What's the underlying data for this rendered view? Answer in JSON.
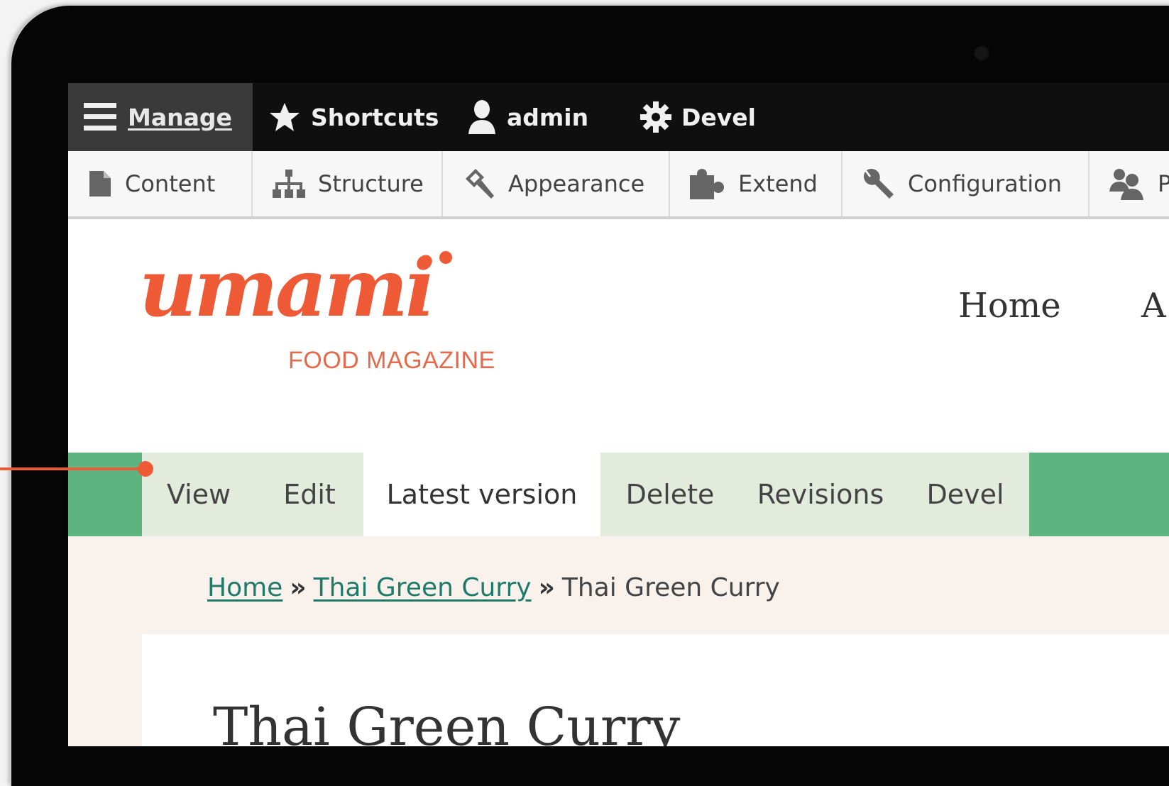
{
  "toolbar": {
    "manage_label": "Manage",
    "shortcuts_label": "Shortcuts",
    "admin_label": "admin",
    "devel_label": "Devel"
  },
  "tray": {
    "items": [
      {
        "label": "Content",
        "icon": "file-icon"
      },
      {
        "label": "Structure",
        "icon": "sitemap-icon"
      },
      {
        "label": "Appearance",
        "icon": "paint-brush-icon"
      },
      {
        "label": "Extend",
        "icon": "puzzle-icon"
      },
      {
        "label": "Configuration",
        "icon": "wrench-icon"
      },
      {
        "label": "P",
        "icon": "people-icon"
      }
    ]
  },
  "site": {
    "logo_text": "umami",
    "logo_sub": "FOOD MAGAZINE",
    "nav": [
      "Home",
      "A"
    ]
  },
  "tabs": [
    "View",
    "Edit",
    "Latest version",
    "Delete",
    "Revisions",
    "Devel"
  ],
  "breadcrumb": {
    "home": "Home",
    "parent": "Thai Green Curry",
    "current": "Thai Green Curry",
    "separator": "»"
  },
  "page": {
    "title": "Thai Green Curry"
  },
  "colors": {
    "toolbar_bg": "#0f0f0f",
    "tabs_green": "#5eb47e",
    "tab_bg": "#e3ebdd",
    "logo_orange": "#e5694a",
    "link_teal": "#1f7a6a",
    "pointer": "#ef5a36"
  }
}
